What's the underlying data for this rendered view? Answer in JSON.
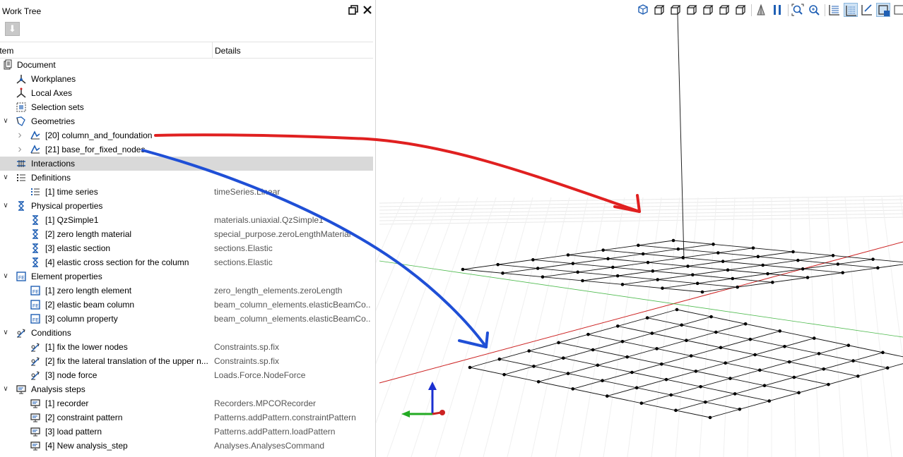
{
  "panel": {
    "title": "Work Tree",
    "float_icon": "float-window-icon",
    "close_icon": "close-icon",
    "toolbar_icon": "move-down-arrow-icon"
  },
  "tree_header": {
    "item": "Item",
    "details": "Details"
  },
  "tree": [
    {
      "label": "Document",
      "details": "",
      "icon": "document-icon",
      "chevron": "none"
    },
    {
      "label": "Workplanes",
      "details": "",
      "icon": "workplanes-icon",
      "chevron": "none"
    },
    {
      "label": "Local Axes",
      "details": "",
      "icon": "local-axes-icon",
      "chevron": "none"
    },
    {
      "label": "Selection sets",
      "details": "",
      "icon": "selection-sets-icon",
      "chevron": "none"
    },
    {
      "label": "Geometries",
      "details": "",
      "icon": "geometries-icon",
      "chevron": "expanded"
    },
    {
      "label": "[20] column_and_foundation",
      "details": "",
      "icon": "geometry-icon",
      "chevron": "collapsed"
    },
    {
      "label": "[21] base_for_fixed_nodes",
      "details": "",
      "icon": "geometry-icon",
      "chevron": "collapsed"
    },
    {
      "label": "Interactions",
      "details": "",
      "icon": "interactions-icon",
      "chevron": "none",
      "selected": true
    },
    {
      "label": "Definitions",
      "details": "",
      "icon": "definitions-icon",
      "chevron": "expanded"
    },
    {
      "label": "[1] time series",
      "details": "timeSeries.Linear",
      "icon": "list-icon",
      "chevron": "none"
    },
    {
      "label": "Physical properties",
      "details": "",
      "icon": "physical-properties-icon",
      "chevron": "expanded"
    },
    {
      "label": "[1] QzSimple1",
      "details": "materials.uniaxial.QzSimple1",
      "icon": "material-icon",
      "chevron": "none"
    },
    {
      "label": "[2] zero length material",
      "details": "special_purpose.zeroLengthMaterial",
      "icon": "material-icon",
      "chevron": "none"
    },
    {
      "label": "[3] elastic section",
      "details": "sections.Elastic",
      "icon": "material-icon",
      "chevron": "none"
    },
    {
      "label": "[4] elastic cross section for the column",
      "details": "sections.Elastic",
      "icon": "material-icon",
      "chevron": "none"
    },
    {
      "label": "Element properties",
      "details": "",
      "icon": "element-properties-icon",
      "chevron": "expanded"
    },
    {
      "label": "[1] zero length element",
      "details": "zero_length_elements.zeroLength",
      "icon": "element-icon",
      "chevron": "none"
    },
    {
      "label": "[2] elastic beam column",
      "details": "beam_column_elements.elasticBeamCo...",
      "icon": "element-icon",
      "chevron": "none"
    },
    {
      "label": "[3] column property",
      "details": "beam_column_elements.elasticBeamCo...",
      "icon": "element-icon",
      "chevron": "none"
    },
    {
      "label": "Conditions",
      "details": "",
      "icon": "conditions-icon",
      "chevron": "expanded"
    },
    {
      "label": "[1] fix the lower nodes",
      "details": "Constraints.sp.fix",
      "icon": "condition-icon",
      "chevron": "none"
    },
    {
      "label": "[2] fix the lateral translation of the upper n...",
      "details": "Constraints.sp.fix",
      "icon": "condition-icon",
      "chevron": "none"
    },
    {
      "label": "[3] node force",
      "details": "Loads.Force.NodeForce",
      "icon": "condition-icon",
      "chevron": "none"
    },
    {
      "label": "Analysis steps",
      "details": "",
      "icon": "analysis-steps-icon",
      "chevron": "expanded"
    },
    {
      "label": "[1] recorder",
      "details": "Recorders.MPCORecorder",
      "icon": "monitor-icon",
      "chevron": "none"
    },
    {
      "label": "[2] constraint pattern",
      "details": "Patterns.addPattern.constraintPattern",
      "icon": "monitor-icon",
      "chevron": "none"
    },
    {
      "label": "[3] load pattern",
      "details": "Patterns.addPattern.loadPattern",
      "icon": "monitor-icon",
      "chevron": "none"
    },
    {
      "label": "[4] New analysis_step",
      "details": "Analyses.AnalysesCommand",
      "icon": "monitor-icon",
      "chevron": "none"
    }
  ],
  "view_toolbar": [
    {
      "icon": "iso-view-icon",
      "active": false
    },
    {
      "icon": "view-front-cube-icon",
      "active": false
    },
    {
      "icon": "view-back-cube-icon",
      "active": false
    },
    {
      "icon": "view-left-cube-icon",
      "active": false
    },
    {
      "icon": "view-right-cube-icon",
      "active": false
    },
    {
      "icon": "view-top-cube-icon",
      "active": false
    },
    {
      "icon": "view-bottom-cube-icon",
      "active": false
    },
    {
      "icon": "perspective-icon",
      "active": false
    },
    {
      "icon": "parallel-projection-icon",
      "active": false
    },
    {
      "icon": "zoom-fit-icon",
      "active": false
    },
    {
      "icon": "zoom-icon",
      "active": false
    },
    {
      "icon": "grid-lines-icon",
      "active": false
    },
    {
      "icon": "grid-dots-icon",
      "active": true
    },
    {
      "icon": "axis-toggle-icon",
      "active": false
    },
    {
      "icon": "selection-box-icon",
      "active": true
    },
    {
      "icon": "render-mode-icon",
      "active": false
    }
  ],
  "colors": {
    "selected_row": "#d9d9d9",
    "arrow_red": "#e02020",
    "arrow_blue": "#1f4fd6",
    "axis_red": "#cc2222",
    "axis_green": "#22aa22",
    "axis_blue": "#1a2fd0",
    "icon_blue": "#1f5fb4"
  }
}
